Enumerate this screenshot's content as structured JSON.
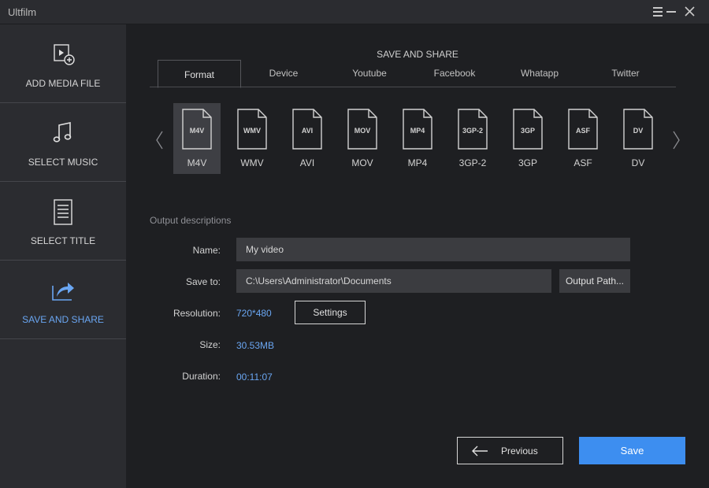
{
  "app": {
    "title": "Ultfilm"
  },
  "sidebar": {
    "items": [
      {
        "label": "ADD MEDIA FILE",
        "icon": "add-media-icon"
      },
      {
        "label": "SELECT MUSIC",
        "icon": "music-note-icon"
      },
      {
        "label": "SELECT TITLE",
        "icon": "document-icon"
      },
      {
        "label": "SAVE AND SHARE",
        "icon": "share-arrow-icon",
        "active": true
      }
    ]
  },
  "main": {
    "section_title": "SAVE AND SHARE",
    "tabs": [
      {
        "label": "Format",
        "active": true
      },
      {
        "label": "Device"
      },
      {
        "label": "Youtube"
      },
      {
        "label": "Facebook"
      },
      {
        "label": "Whatapp"
      },
      {
        "label": "Twitter"
      }
    ],
    "formats": [
      {
        "icon_text": "M4V",
        "label": "M4V",
        "selected": true
      },
      {
        "icon_text": "WMV",
        "label": "WMV"
      },
      {
        "icon_text": "AVI",
        "label": "AVI"
      },
      {
        "icon_text": "MOV",
        "label": "MOV"
      },
      {
        "icon_text": "MP4",
        "label": "MP4"
      },
      {
        "icon_text": "3GP-2",
        "label": "3GP-2"
      },
      {
        "icon_text": "3GP",
        "label": "3GP"
      },
      {
        "icon_text": "ASF",
        "label": "ASF"
      },
      {
        "icon_text": "DV",
        "label": "DV"
      }
    ],
    "output": {
      "heading": "Output descriptions",
      "name_label": "Name:",
      "name_value": "My video",
      "save_to_label": "Save to:",
      "save_to_value": "C:\\Users\\Administrator\\Documents",
      "output_path_button": "Output Path...",
      "resolution_label": "Resolution:",
      "resolution_value": "720*480",
      "settings_button": "Settings",
      "size_label": "Size:",
      "size_value": "30.53MB",
      "duration_label": "Duration:",
      "duration_value": "00:11:07"
    },
    "previous_button": "Previous",
    "save_button": "Save"
  },
  "colors": {
    "accent": "#3d8ef0",
    "link_blue": "#6aa6f2",
    "sidebar_bg": "#2b2c30",
    "main_bg": "#1e1f22"
  }
}
